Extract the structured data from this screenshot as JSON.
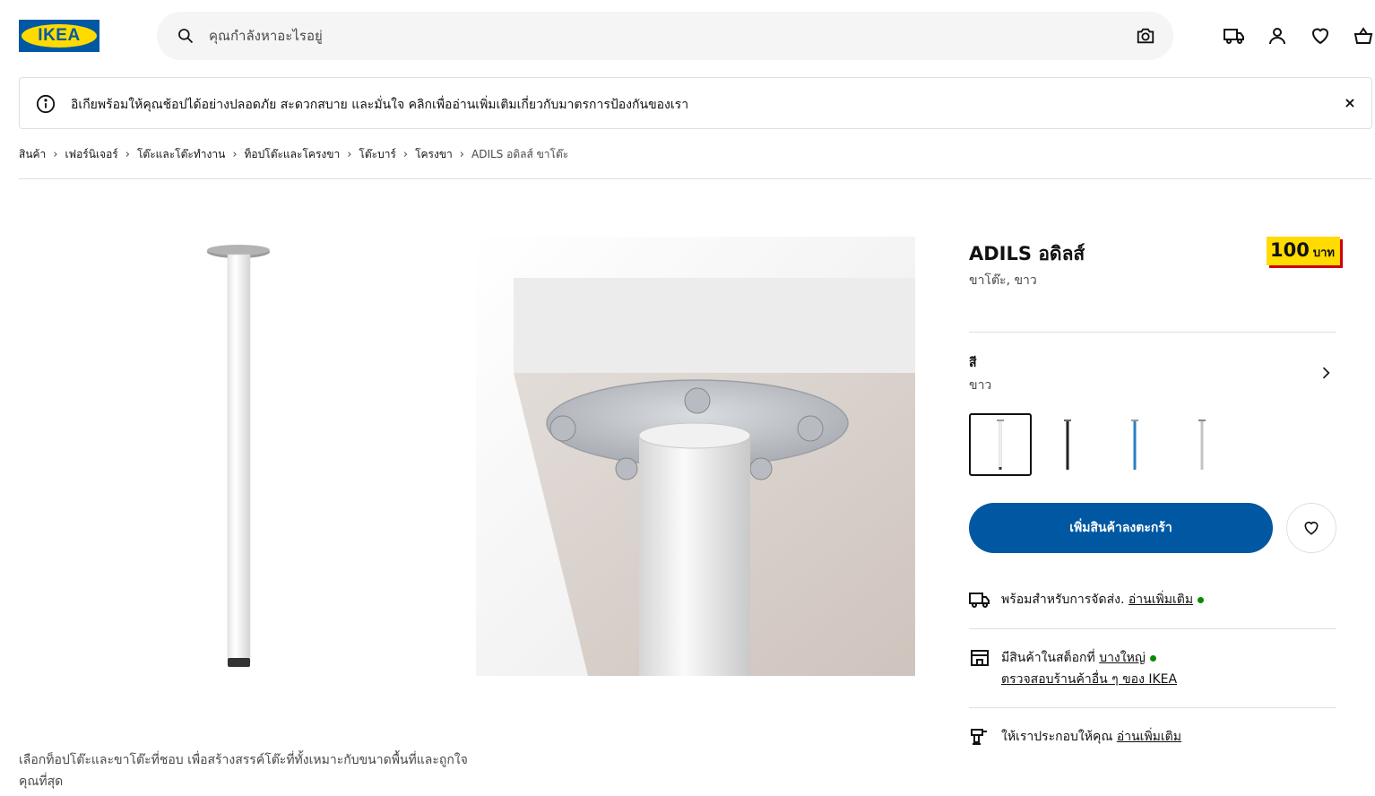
{
  "header": {
    "logo_text": "IKEA",
    "search_placeholder": "คุณกำลังหาอะไรอยู่"
  },
  "notice": {
    "text": "อิเกียพร้อมให้คุณช้อปได้อย่างปลอดภัย สะดวกสบาย และมั่นใจ คลิกเพื่ออ่านเพิ่มเติมเกี่ยวกับมาตรการป้องกันของเรา",
    "close_label": "×"
  },
  "breadcrumb": {
    "items": [
      "สินค้า",
      "เฟอร์นิเจอร์",
      "โต๊ะและโต๊ะทำงาน",
      "ท็อปโต๊ะและโครงขา",
      "โต๊ะบาร์",
      "โครงขา"
    ],
    "current": "ADILS อดิลส์ ขาโต๊ะ",
    "separator": "›"
  },
  "product": {
    "name": "ADILS อดิลส์",
    "subtitle": "ขาโต๊ะ, ขาว",
    "price": "100",
    "currency": "บาท",
    "description": "เลือกท็อปโต๊ะและขาโต๊ะที่ชอบ เพื่อสร้างสรรค์โต๊ะที่ทั้งเหมาะกับขนาดพื้นที่และถูกใจคุณที่สุด"
  },
  "color": {
    "label": "สี",
    "value": "ขาว",
    "swatches": [
      {
        "name": "white",
        "color": "#f0f0f0",
        "selected": true
      },
      {
        "name": "black",
        "color": "#222222",
        "selected": false
      },
      {
        "name": "blue",
        "color": "#2a7fc1",
        "selected": false
      },
      {
        "name": "silver",
        "color": "#b8b8b8",
        "selected": false
      }
    ]
  },
  "actions": {
    "add_to_cart": "เพิ่มสินค้าลงตะกร้า"
  },
  "delivery": {
    "text": "พร้อมสำหรับการจัดส่ง.",
    "link": "อ่านเพิ่มเติม"
  },
  "stock": {
    "text": "มีสินค้าในสต็อกที่",
    "store_link": "บางใหญ่",
    "check_link": "ตรวจสอบร้านค้าอื่น ๆ ของ IKEA"
  },
  "assembly": {
    "text": "ให้เราประกอบให้คุณ",
    "link": "อ่านเพิ่มเติม"
  },
  "colors": {
    "ikea_blue": "#0058a3",
    "ikea_yellow": "#ffdb00",
    "price_shadow": "#cc0008",
    "stock_green": "#0a8a00"
  }
}
